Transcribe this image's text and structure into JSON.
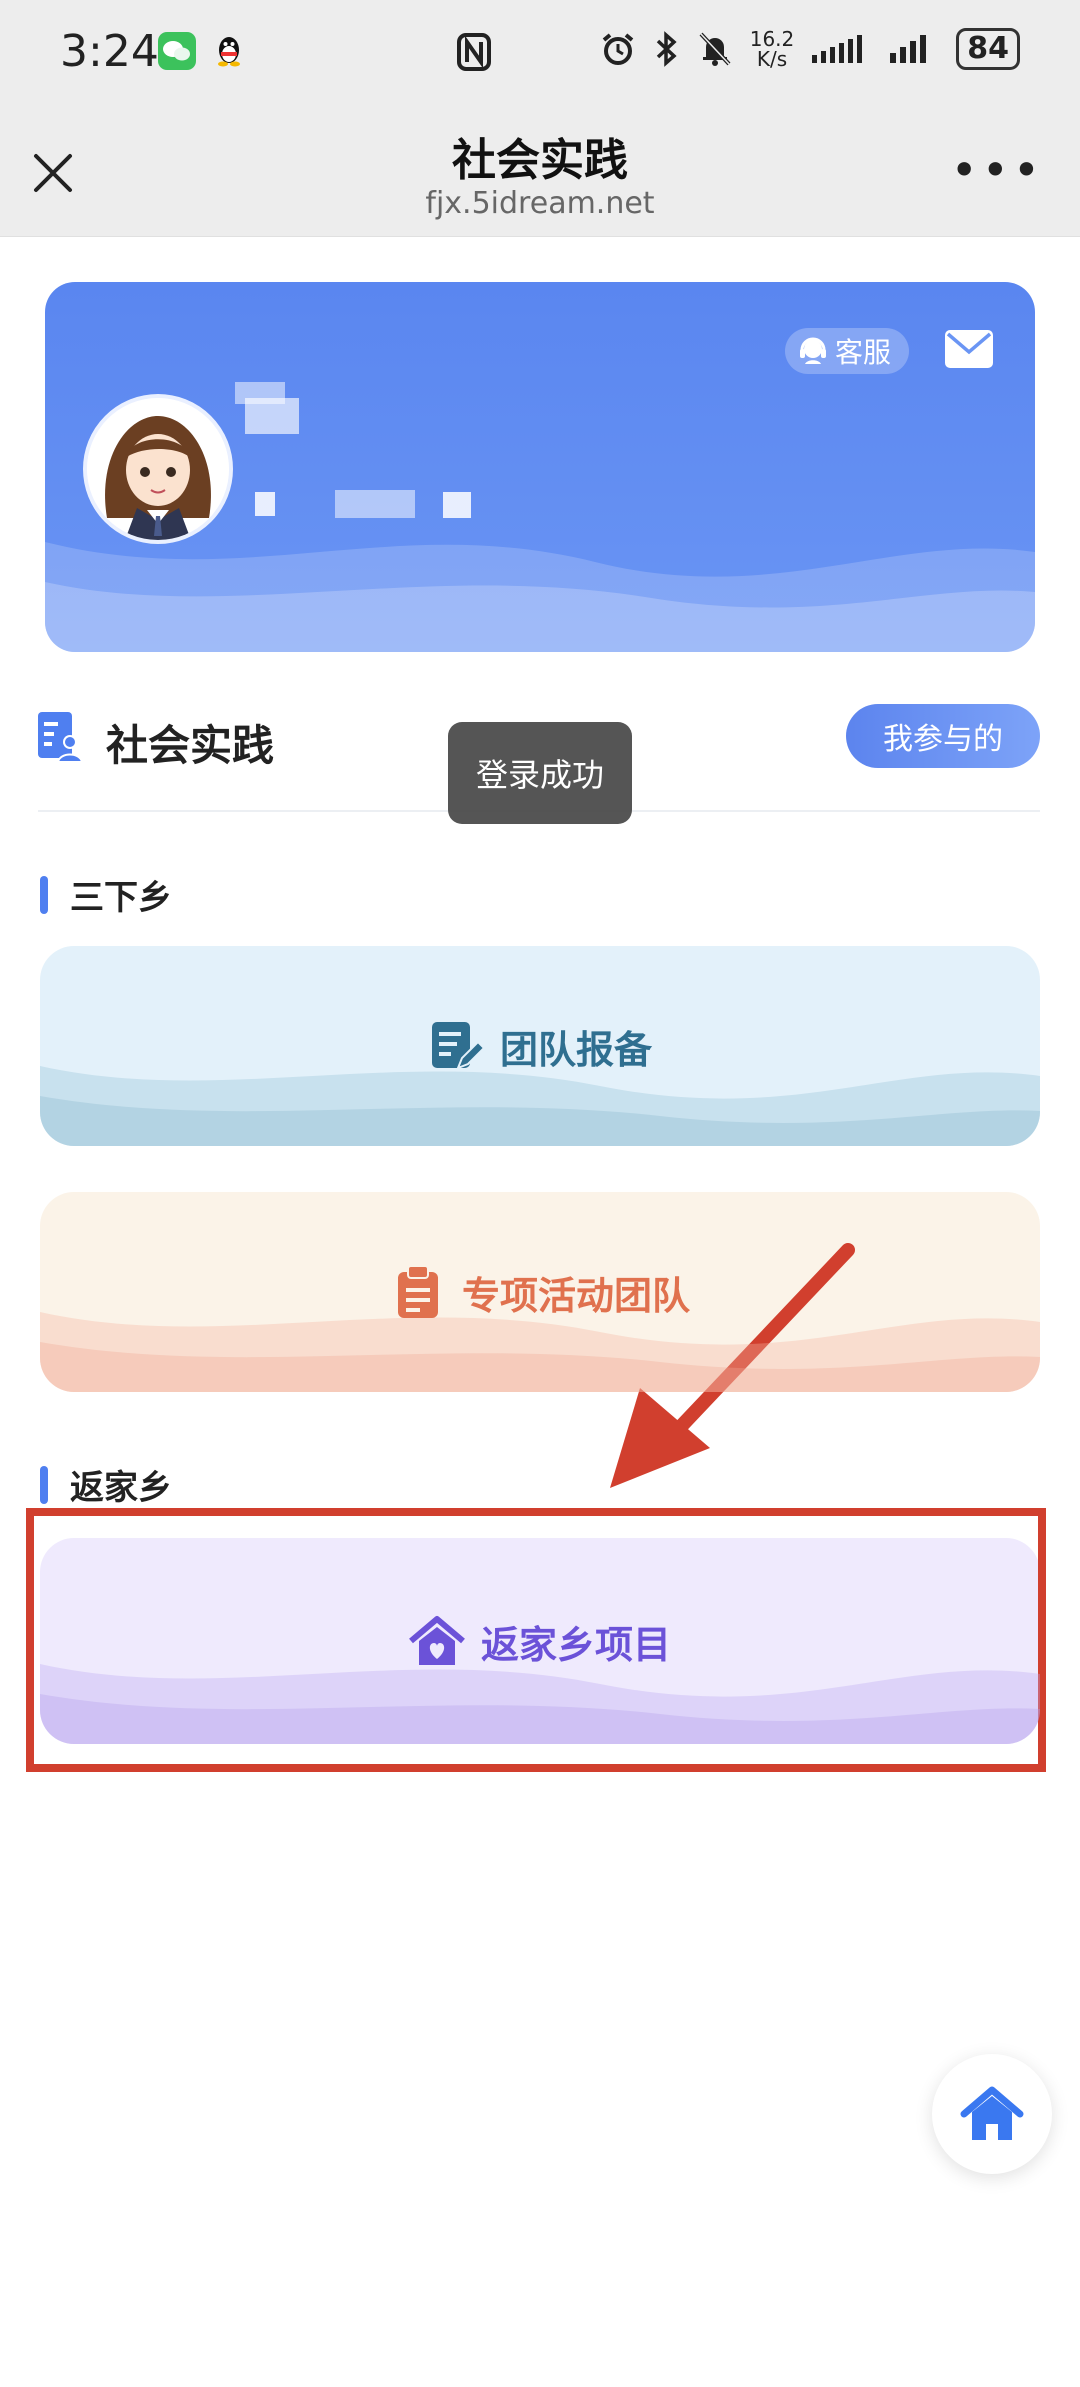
{
  "status_bar": {
    "time": "3:24",
    "net_speed_value": "16.2",
    "net_speed_unit": "K/s",
    "battery": "84",
    "icons": [
      "wechat-icon",
      "qq-icon",
      "nfc-icon",
      "alarm-icon",
      "bluetooth-icon",
      "mute-icon",
      "signal-icon",
      "signal-icon",
      "battery-icon"
    ]
  },
  "nav": {
    "title": "社会实践",
    "url": "fjx.5idream.net",
    "close_icon": "close-icon",
    "more_label": "•••"
  },
  "profile": {
    "service_label": "客服",
    "mail_icon": "mail-icon"
  },
  "section": {
    "title": "社会实践",
    "joined_button": "我参与的"
  },
  "toast": {
    "text": "登录成功"
  },
  "groups": [
    {
      "label": "三下乡",
      "cards": [
        {
          "label": "团队报备",
          "icon": "edit-document-icon",
          "color": "#2f6f90",
          "bg": "#e3f1fa"
        },
        {
          "label": "专项活动团队",
          "icon": "clipboard-icon",
          "color": "#e0714e",
          "bg": "#fbf3e8"
        }
      ]
    },
    {
      "label": "返家乡",
      "cards": [
        {
          "label": "返家乡项目",
          "icon": "home-heart-icon",
          "color": "#6b52d8",
          "bg": "#efeafd"
        }
      ]
    }
  ],
  "fab": {
    "icon": "home-icon"
  },
  "annotation": {
    "box_color": "#d13f2e"
  }
}
